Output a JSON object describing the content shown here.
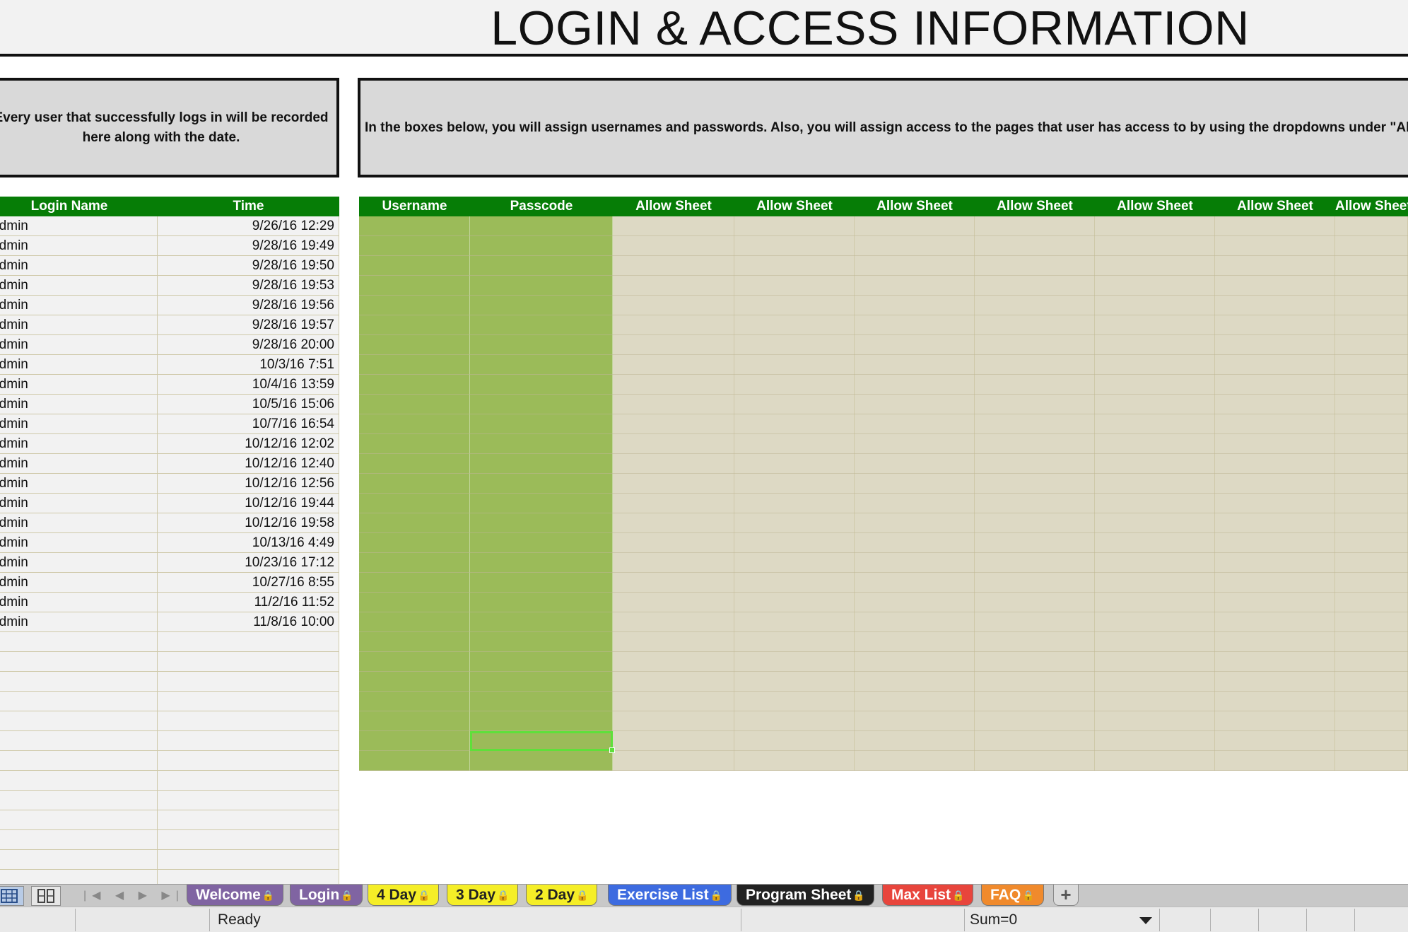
{
  "page_title": "LOGIN & ACCESS INFORMATION",
  "info_left": "Every user that successfully logs in will be recorded here along with the date.",
  "info_right": "In the boxes below, you will assign usernames and passwords.  Also, you will assign access to the pages that user has access to by using the dropdowns under \"Allow Sheet\".",
  "login_log": {
    "headers": {
      "name": "Login Name",
      "time": "Time"
    },
    "rows": [
      {
        "name": "Admin",
        "time": "9/26/16 12:29"
      },
      {
        "name": "Admin",
        "time": "9/28/16 19:49"
      },
      {
        "name": "Admin",
        "time": "9/28/16 19:50"
      },
      {
        "name": "Admin",
        "time": "9/28/16 19:53"
      },
      {
        "name": "Admin",
        "time": "9/28/16 19:56"
      },
      {
        "name": "Admin",
        "time": "9/28/16 19:57"
      },
      {
        "name": "Admin",
        "time": "9/28/16 20:00"
      },
      {
        "name": "Admin",
        "time": "10/3/16 7:51"
      },
      {
        "name": "Admin",
        "time": "10/4/16 13:59"
      },
      {
        "name": "Admin",
        "time": "10/5/16 15:06"
      },
      {
        "name": "Admin",
        "time": "10/7/16 16:54"
      },
      {
        "name": "Admin",
        "time": "10/12/16 12:02"
      },
      {
        "name": "Admin",
        "time": "10/12/16 12:40"
      },
      {
        "name": "Admin",
        "time": "10/12/16 12:56"
      },
      {
        "name": "Admin",
        "time": "10/12/16 19:44"
      },
      {
        "name": "Admin",
        "time": "10/12/16 19:58"
      },
      {
        "name": "Admin",
        "time": "10/13/16 4:49"
      },
      {
        "name": "Admin",
        "time": "10/23/16 17:12"
      },
      {
        "name": "Admin",
        "time": "10/27/16 8:55"
      },
      {
        "name": "Admin",
        "time": "11/2/16 11:52"
      },
      {
        "name": "Admin",
        "time": "11/8/16 10:00"
      },
      {
        "name": "",
        "time": ""
      },
      {
        "name": "",
        "time": ""
      },
      {
        "name": "",
        "time": ""
      },
      {
        "name": "",
        "time": ""
      },
      {
        "name": "",
        "time": ""
      },
      {
        "name": "",
        "time": ""
      },
      {
        "name": "",
        "time": ""
      },
      {
        "name": "",
        "time": ""
      },
      {
        "name": "",
        "time": ""
      },
      {
        "name": "",
        "time": ""
      },
      {
        "name": "",
        "time": ""
      },
      {
        "name": "",
        "time": ""
      },
      {
        "name": "",
        "time": ""
      }
    ]
  },
  "access_grid": {
    "headers": [
      "Username",
      "Passcode",
      "Allow Sheet",
      "Allow Sheet",
      "Allow Sheet",
      "Allow Sheet",
      "Allow Sheet",
      "Allow Sheet",
      "Allow Sheet"
    ]
  },
  "colors": {
    "header_green": "#067d06",
    "cell_green": "#9bbb59",
    "cell_tan": "#ddd9c4",
    "grid_line": "#cfc9a9"
  },
  "sheet_tabs": [
    {
      "label": "Welcome",
      "locked": true,
      "bg": "#8064a2",
      "fg": "#ffffff"
    },
    {
      "label": "Login",
      "locked": true,
      "bg": "#8064a2",
      "fg": "#ffffff",
      "active": true
    },
    {
      "label": "4 Day",
      "locked": true,
      "bg": "#f5ee27",
      "fg": "#222222"
    },
    {
      "label": "3 Day",
      "locked": true,
      "bg": "#f5ee27",
      "fg": "#222222"
    },
    {
      "label": "2 Day",
      "locked": true,
      "bg": "#f5ee27",
      "fg": "#222222"
    },
    {
      "label": "Exercise List",
      "locked": true,
      "bg": "#3d6be0",
      "fg": "#ffffff"
    },
    {
      "label": "Program Sheet",
      "locked": true,
      "bg": "#222222",
      "fg": "#ffffff"
    },
    {
      "label": "Max List",
      "locked": true,
      "bg": "#e8453c",
      "fg": "#ffffff"
    },
    {
      "label": "FAQ",
      "locked": true,
      "bg": "#f08a2c",
      "fg": "#ffffff"
    }
  ],
  "status": {
    "ready": "Ready",
    "sum": "Sum=0"
  },
  "icons": {
    "lock": "lock-icon",
    "add_sheet": "plus-icon",
    "view_normal": "normal-view-icon",
    "view_layout": "page-layout-view-icon"
  }
}
